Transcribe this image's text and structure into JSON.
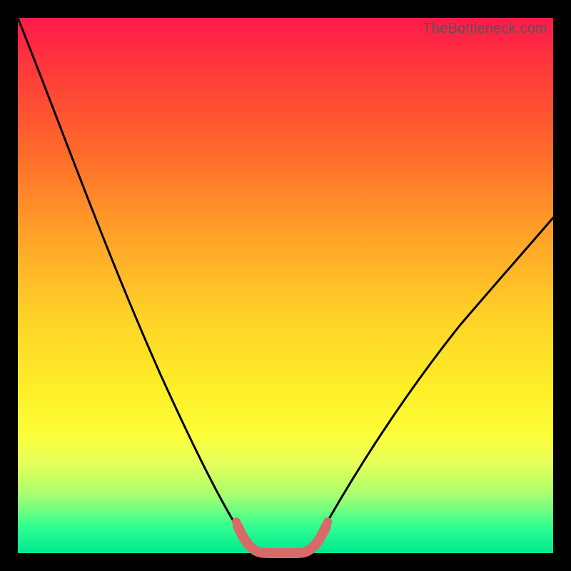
{
  "watermark": "TheBottleneck.com",
  "colors": {
    "frame": "#000000",
    "gradient_top": "#ff1a4b",
    "gradient_bottom": "#00e890",
    "curve": "#000000",
    "trough_marker": "#d86a6a"
  },
  "chart_data": {
    "type": "line",
    "title": "",
    "xlabel": "",
    "ylabel": "",
    "xlim": [
      0,
      100
    ],
    "ylim": [
      0,
      100
    ],
    "grid": false,
    "legend": false,
    "series": [
      {
        "name": "bottleneck-curve",
        "x": [
          0,
          5,
          10,
          15,
          20,
          25,
          30,
          34,
          38,
          41,
          43,
          45,
          47,
          50,
          52,
          55,
          60,
          65,
          70,
          75,
          80,
          85,
          90,
          95,
          100
        ],
        "values": [
          100,
          90,
          80,
          70,
          59,
          48,
          36,
          25,
          14,
          6,
          2,
          0,
          0,
          0,
          2,
          7,
          17,
          26,
          34,
          41,
          47,
          52,
          57,
          61,
          65
        ]
      }
    ],
    "annotations": [
      {
        "name": "trough-band",
        "x_start": 41,
        "x_end": 53,
        "style": "pink-rounded"
      }
    ]
  }
}
